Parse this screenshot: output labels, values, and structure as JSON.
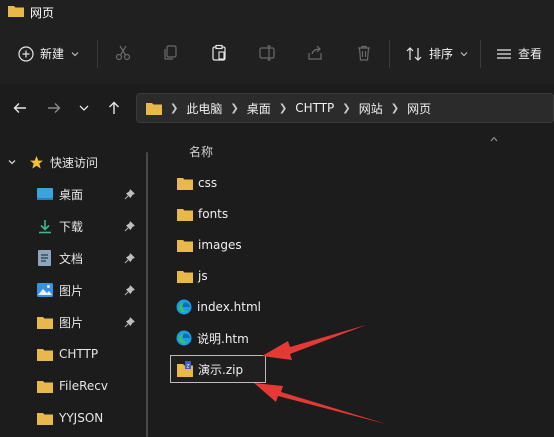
{
  "window": {
    "title": "网页"
  },
  "toolbar": {
    "new_label": "新建",
    "sort_label": "排序",
    "view_label": "查看",
    "icons": [
      "cut-icon",
      "copy-icon",
      "paste-icon",
      "rename-icon",
      "share-icon",
      "delete-icon"
    ]
  },
  "nav": {
    "breadcrumb": [
      "此电脑",
      "桌面",
      "CHTTP",
      "网站",
      "网页"
    ]
  },
  "sidebar": {
    "items": [
      {
        "label": "快速访问",
        "icon": "star-icon"
      },
      {
        "label": "桌面",
        "icon": "desktop-icon",
        "pinned": true
      },
      {
        "label": "下载",
        "icon": "download-icon",
        "pinned": true
      },
      {
        "label": "文档",
        "icon": "document-icon",
        "pinned": true
      },
      {
        "label": "图片",
        "icon": "picture-icon",
        "pinned": true
      },
      {
        "label": "图片",
        "icon": "folder-icon",
        "pinned": true
      },
      {
        "label": "CHTTP",
        "icon": "folder-icon"
      },
      {
        "label": "FileRecv",
        "icon": "folder-icon"
      },
      {
        "label": "YYJSON",
        "icon": "folder-icon"
      }
    ]
  },
  "list": {
    "column_name": "名称",
    "files": [
      {
        "name": "css",
        "icon": "folder-icon"
      },
      {
        "name": "fonts",
        "icon": "folder-icon"
      },
      {
        "name": "images",
        "icon": "folder-icon"
      },
      {
        "name": "js",
        "icon": "folder-icon"
      },
      {
        "name": "index.html",
        "icon": "edge-icon"
      },
      {
        "name": "说明.htm",
        "icon": "edge-icon"
      },
      {
        "name": "演示.zip",
        "icon": "zip-icon",
        "selected": true
      }
    ]
  },
  "colors": {
    "folder": "#e8b84a",
    "accent_blue": "#3b8ee8",
    "arrow_red": "#e53935"
  }
}
